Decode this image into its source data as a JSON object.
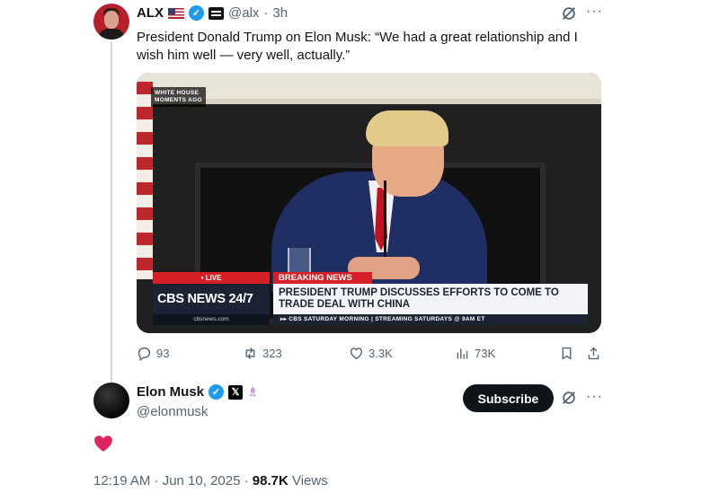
{
  "tweet": {
    "author_name": "ALX",
    "handle": "@alx",
    "time": "3h",
    "text": "President Donald Trump on Elon Musk: “We had a great relationship and I wish him well — very well, actually.”",
    "media": {
      "overlay_top": "WHITE HOUSE\nMOMENTS AGO",
      "live_label": "• LIVE",
      "breaking_label": "BREAKING NEWS",
      "brand": "CBS NEWS 24/7",
      "headline": "PRESIDENT TRUMP DISCUSSES EFFORTS TO COME TO TRADE DEAL WITH CHINA",
      "site": "cbsnews.com",
      "ticker": "▸▸ CBS SATURDAY MORNING | STREAMING SATURDAYS @ 9AM ET"
    },
    "actions": {
      "replies": "93",
      "reposts": "323",
      "likes": "3.3K",
      "views": "73K"
    }
  },
  "reply": {
    "author_name": "Elon Musk",
    "handle": "@elonmusk",
    "subscribe_label": "Subscribe",
    "heart_emoji": "❤️",
    "meta": {
      "timestamp": "12:19 AM · Jun 10, 2025 · ",
      "views_count": "98.7K",
      "views_label": " Views"
    }
  },
  "icons": [
    "verified-icon",
    "flag-us-icon",
    "affiliation-icon",
    "grok-icon",
    "more-icon",
    "reply-icon",
    "repost-icon",
    "like-icon",
    "views-icon",
    "bookmark-icon",
    "share-icon",
    "x-badge-icon",
    "heart-icon"
  ],
  "colors": {
    "verified": "#1d9bf0",
    "text": "#0f1419",
    "muted": "#536471",
    "cbs_red": "#d61f26",
    "heart": "#e0245e"
  }
}
